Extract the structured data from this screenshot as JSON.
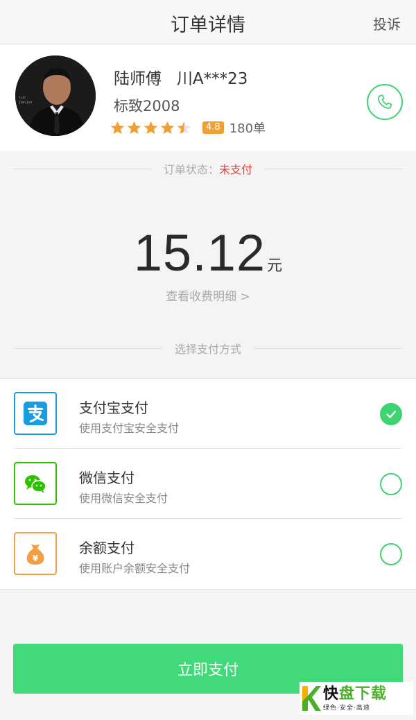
{
  "header": {
    "title": "订单详情",
    "complain_label": "投诉"
  },
  "driver": {
    "name": "陆师傅   川A***23",
    "car_model": "标致2008",
    "rating": 4.5,
    "score": "4.8",
    "orders": "180单",
    "phone_icon": "phone-icon"
  },
  "order_status": {
    "label": "订单状态：",
    "value": "未支付",
    "value_color": "#e5403b"
  },
  "amount": {
    "value": "15.12",
    "unit": "元",
    "detail_link": "查看收费明细 >"
  },
  "payment_section": {
    "label": "选择支付方式"
  },
  "payment_methods": [
    {
      "title": "支付宝支付",
      "desc": "使用支付宝安全支付",
      "icon": "alipay-icon",
      "color": "#1a9de0",
      "selected": true
    },
    {
      "title": "微信支付",
      "desc": "使用微信安全支付",
      "icon": "wechat-icon",
      "color": "#2dc100",
      "selected": false
    },
    {
      "title": "余额支付",
      "desc": "使用账户余额安全支付",
      "icon": "money-bag-icon",
      "color": "#f0a040",
      "selected": false
    }
  ],
  "pay_button": {
    "label": "立即支付"
  },
  "watermark": {
    "main_black": "快",
    "main_green": "盘下载",
    "sub": "绿色·安全·高速"
  },
  "colors": {
    "accent": "#41d97a",
    "status_red": "#e5403b",
    "star": "#f0a030"
  }
}
